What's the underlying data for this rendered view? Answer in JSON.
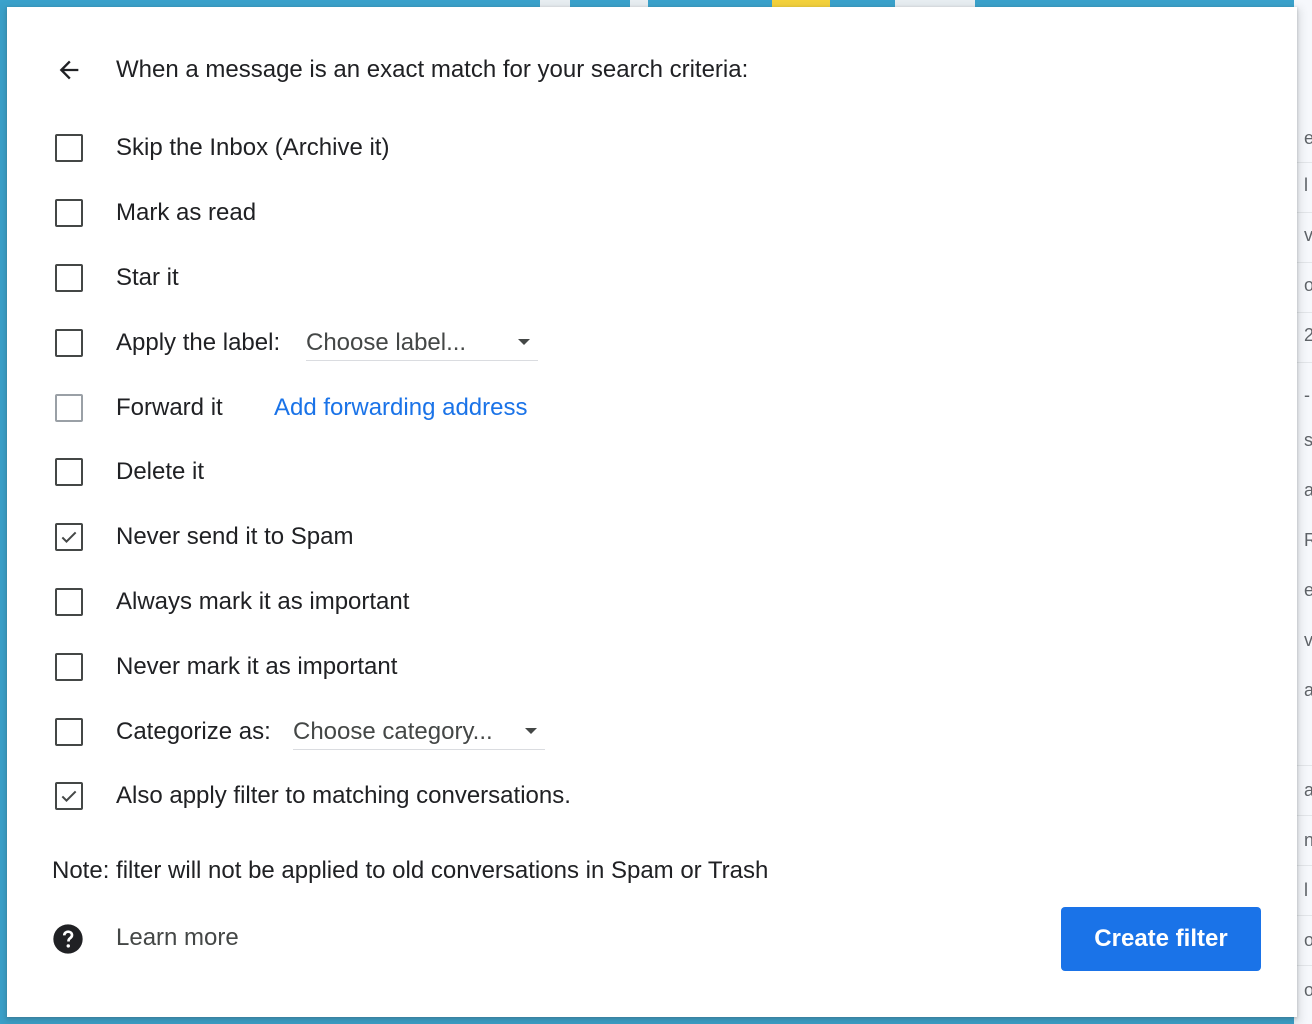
{
  "header": {
    "back_icon": "arrow-back-icon",
    "text": "When a message is an exact match for your search criteria:"
  },
  "options": [
    {
      "label": "Skip the Inbox (Archive it)",
      "checked": false
    },
    {
      "label": "Mark as read",
      "checked": false
    },
    {
      "label": "Star it",
      "checked": false
    },
    {
      "label": "Apply the label:",
      "checked": false,
      "select_value": "Choose label..."
    },
    {
      "label": "Forward it",
      "checked": false,
      "disabled": true,
      "link": "Add forwarding address"
    },
    {
      "label": "Delete it",
      "checked": false
    },
    {
      "label": "Never send it to Spam",
      "checked": true
    },
    {
      "label": "Always mark it as important",
      "checked": false
    },
    {
      "label": "Never mark it as important",
      "checked": false
    },
    {
      "label": "Categorize as:",
      "checked": false,
      "select_value": "Choose category..."
    },
    {
      "label": "Also apply filter to matching conversations.",
      "checked": true
    }
  ],
  "note": "Note: filter will not be applied to old conversations in Spam or Trash",
  "footer": {
    "help_icon": "help-circle-icon",
    "learn_more": "Learn more",
    "create_button": "Create filter"
  },
  "colors": {
    "accent": "#1a73e8",
    "checkbox_border": "#444746",
    "checkbox_disabled": "#9aa0a6",
    "background_window": "#3aa2cc"
  },
  "background_app": {
    "glyphs": [
      "e",
      "l",
      "v",
      "o",
      "2",
      "-",
      "s",
      "a",
      "R",
      "e",
      "v",
      "a",
      "a",
      "n",
      "l",
      "o",
      "o"
    ]
  }
}
